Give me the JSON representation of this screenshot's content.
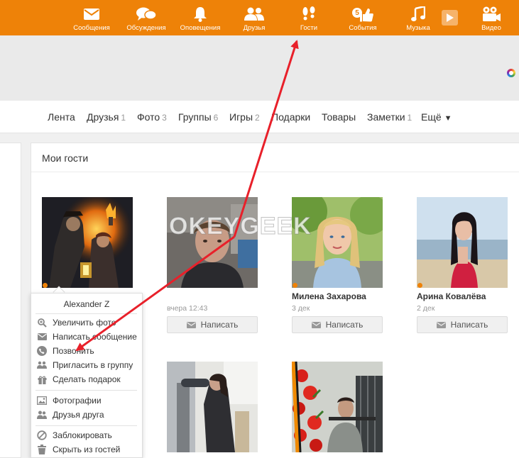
{
  "topnav": [
    {
      "id": "messages",
      "label": "Сообщения",
      "icon": "envelope-icon"
    },
    {
      "id": "discussions",
      "label": "Обсуждения",
      "icon": "speech-bubbles-icon"
    },
    {
      "id": "notifications",
      "label": "Оповещения",
      "icon": "bell-icon"
    },
    {
      "id": "friends",
      "label": "Друзья",
      "icon": "people-icon"
    },
    {
      "id": "guests",
      "label": "Гости",
      "icon": "footprints-icon"
    },
    {
      "id": "events",
      "label": "События",
      "icon": "thumbs-up-icon",
      "badge": "5"
    },
    {
      "id": "music",
      "label": "Музыка",
      "icon": "music-note-icon"
    },
    {
      "id": "video",
      "label": "Видео",
      "icon": "film-camera-icon"
    }
  ],
  "tabs": [
    {
      "label": "Лента",
      "count": ""
    },
    {
      "label": "Друзья",
      "count": "1"
    },
    {
      "label": "Фото",
      "count": "3"
    },
    {
      "label": "Группы",
      "count": "6"
    },
    {
      "label": "Игры",
      "count": "2"
    },
    {
      "label": "Подарки",
      "count": ""
    },
    {
      "label": "Товары",
      "count": ""
    },
    {
      "label": "Заметки",
      "count": "1"
    },
    {
      "label": "Ещё",
      "count": "",
      "caret": "▼"
    }
  ],
  "guests_panel": {
    "title": "Мои гости",
    "write_label": "Написать",
    "guests": [
      {
        "name": "Alexander Z",
        "date": "",
        "online": true
      },
      {
        "name": "",
        "date": "вчера 12:43",
        "online": false
      },
      {
        "name": "Милена Захарова",
        "date": "3 дек",
        "online": true
      },
      {
        "name": "Арина Ковалёва",
        "date": "2 дек",
        "online": true
      },
      {
        "name": "",
        "date": "",
        "online": false
      },
      {
        "name": "",
        "date": "",
        "online": false
      }
    ]
  },
  "context_menu": {
    "title": "Alexander Z",
    "groups": [
      [
        {
          "label": "Увеличить фото",
          "icon": "zoom-in-icon"
        },
        {
          "label": "Написать сообщение",
          "icon": "envelope-icon"
        },
        {
          "label": "Позвонить",
          "icon": "phone-icon"
        },
        {
          "label": "Пригласить в группу",
          "icon": "group-invite-icon"
        },
        {
          "label": "Сделать подарок",
          "icon": "gift-icon"
        }
      ],
      [
        {
          "label": "Фотографии",
          "icon": "photos-icon"
        },
        {
          "label": "Друзья друга",
          "icon": "friends-icon"
        }
      ],
      [
        {
          "label": "Заблокировать",
          "icon": "block-icon"
        },
        {
          "label": "Скрыть из гостей",
          "icon": "trash-icon"
        }
      ]
    ]
  },
  "watermark": "OKEYGEEK",
  "colors": {
    "brand_orange": "#ee8208",
    "annotation_red": "#e8202a"
  }
}
